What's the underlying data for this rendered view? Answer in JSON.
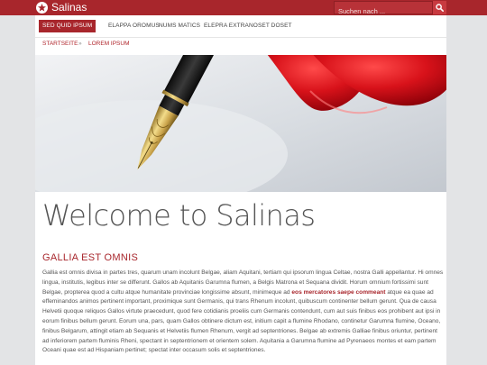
{
  "header": {
    "site_title": "Salinas",
    "search_placeholder": "Suchen nach ...",
    "logo_icon": "star-badge-icon",
    "search_icon": "search-icon"
  },
  "nav": {
    "items": [
      {
        "label": "SED QUID IPSUM",
        "active": true
      },
      {
        "label": "ELAPPA OROMUS",
        "active": false
      },
      {
        "label": "NUMS MATICS",
        "active": false
      },
      {
        "label": "ELEPRA EXTRA",
        "active": false
      },
      {
        "label": "NOSET DOSET",
        "active": false
      }
    ]
  },
  "breadcrumb": {
    "home": "STARTSEITE",
    "separator": "»",
    "current": "LOREM IPSUM"
  },
  "main": {
    "title": "Welcome to Salinas",
    "subheading": "GALLIA EST OMNIS",
    "paragraph_before": "Gallia est omnis divisa in partes tres, quarum unam incolunt Belgae, aliam Aquitani, tertiam qui ipsorum lingua Celtae, nostra Galli appellantur. Hi omnes lingua, institutis, legibus inter se differunt. Gallos ab Aquitanis Garumna flumen, a Belgis Matrona et Sequana dividit. Horum omnium fortissimi sunt Belgae, propterea quod a cultu atque humanitate provinciae longissime absunt, minimeque ad ",
    "paragraph_highlight": "eos mercatores saepe commeant",
    "paragraph_after": " atque ea quae ad effeminandos animos pertinent important, proximique sunt Germanis, qui trans Rhenum incolunt, quibuscum continenter bellum gerunt. Qua de causa Helvetii quoque reliquos Gallos virtute praecedunt, quod fere cotidianis proeliis cum Germanis contendunt, cum aut suis finibus eos prohibent aut ipsi in eorum finibus bellum gerunt. Eorum una, pars, quam Gallos obtinere dictum est, initium capit a flumine Rhodano, continetur Garumna flumine, Oceano, finibus Belgarum, attingit etiam ab Sequanis et Helvetiis flumen Rhenum, vergit ad septentriones. Belgae ab extremis Galliae finibus oriuntur, pertinent ad inferiorem partem fluminis Rheni, spectant in septentrionem et orientem solem. Aquitania a Garumna flumine ad Pyrenaeos montes et eam partem Oceani quae est ad Hispaniam pertinet; spectat inter occasum solis et septentriones."
  },
  "colors": {
    "accent": "#a8262c",
    "page_background": "#e3e4e6",
    "content_background": "#ffffff"
  }
}
